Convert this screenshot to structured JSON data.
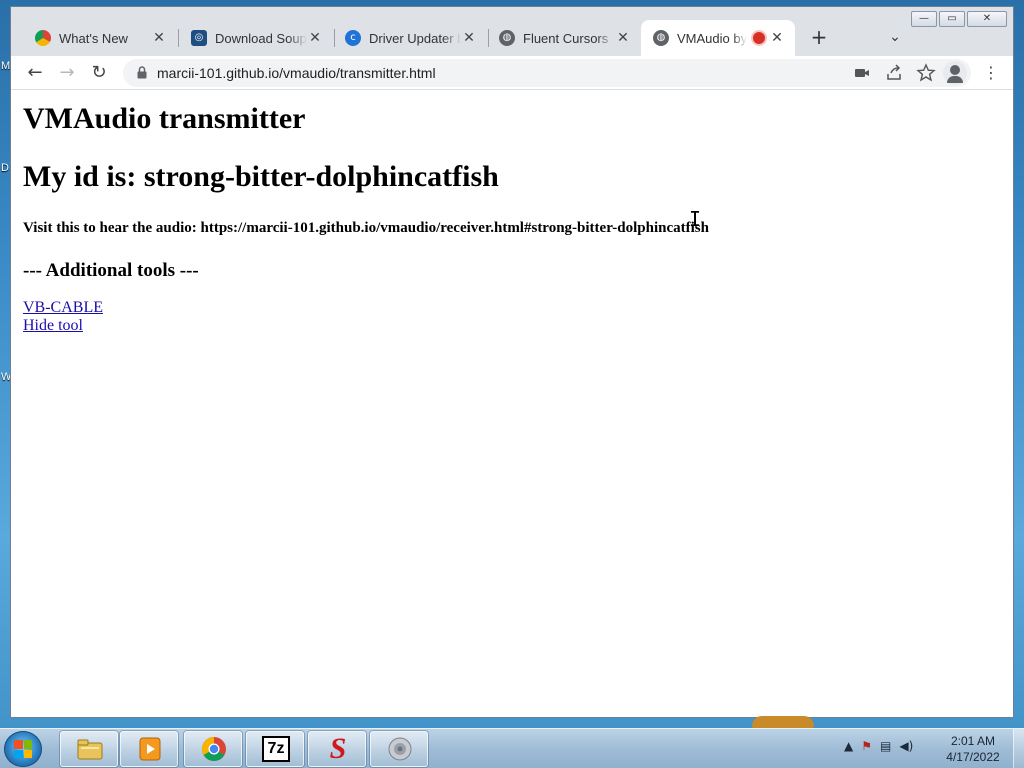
{
  "desktop": {
    "edge_letters": [
      "M",
      "D",
      "W"
    ]
  },
  "window": {
    "controls": {
      "minimize": "—",
      "maximize": "▭",
      "close": "✕"
    }
  },
  "tabs": [
    {
      "title": "What's New",
      "icon": "chrome-icon",
      "active": false
    },
    {
      "title": "Download Soupt",
      "icon": "soupt-icon",
      "active": false
    },
    {
      "title": "Driver Updater b",
      "icon": "driver-updater-icon",
      "active": false
    },
    {
      "title": "Fluent Cursors",
      "icon": "globe-icon",
      "active": false
    },
    {
      "title": "VMAudio by",
      "icon": "globe-icon",
      "active": true,
      "recording": true
    }
  ],
  "toolbar": {
    "url": "marcii-101.github.io/vmaudio/transmitter.html",
    "back": "←",
    "forward": "→",
    "reload": "↻",
    "menu": "⋮",
    "new_tab": "+",
    "tab_search": "⌄"
  },
  "page": {
    "title": "VMAudio transmitter",
    "id_line": "My id is: strong-bitter-dolphincatfish",
    "visit_line": "Visit this to hear the audio: https://marcii-101.github.io/vmaudio/receiver.html#strong-bitter-dolphincatfish",
    "tools_heading": "--- Additional tools ---",
    "links": [
      "VB-CABLE",
      "Hide tool"
    ]
  },
  "taskbar": {
    "time": "2:01 AM",
    "date": "4/17/2022",
    "apps": [
      "explorer-icon",
      "media-player-icon",
      "chrome-icon",
      "7zip-icon",
      "s-app-icon",
      "speaker-icon"
    ],
    "app_7z_label": "7z",
    "app_s_label": "S"
  }
}
